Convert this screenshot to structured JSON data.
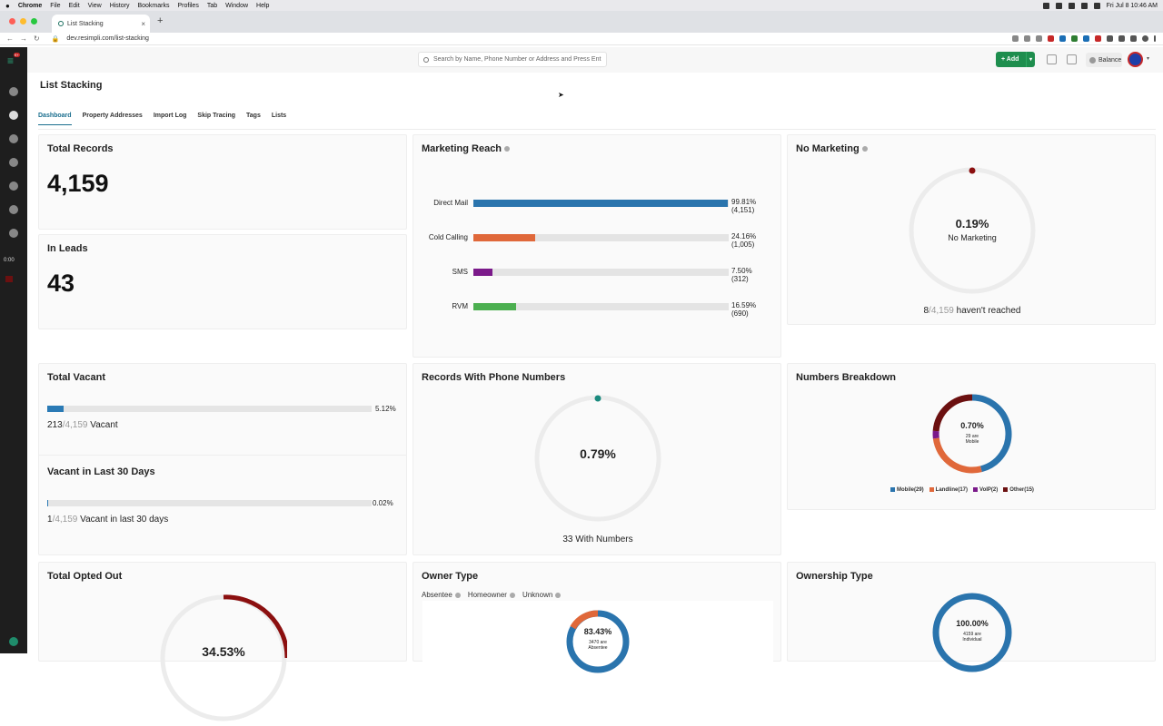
{
  "os_menu": {
    "app": "Chrome",
    "items": [
      "File",
      "Edit",
      "View",
      "History",
      "Bookmarks",
      "Profiles",
      "Tab",
      "Window",
      "Help"
    ],
    "clock": "Fri Jul 8  10:46 AM"
  },
  "browser": {
    "tab_title": "List Stacking",
    "url": "dev.resimpli.com/list-stacking"
  },
  "sidebar": {
    "badge": "9+",
    "timer": "0:00"
  },
  "topbar": {
    "search_placeholder": "Search by Name, Phone Number or Address and Press Ent",
    "add_label": "+ Add",
    "balance_label": "Balance"
  },
  "page": {
    "title": "List Stacking"
  },
  "tabs": [
    "Dashboard",
    "Property Addresses",
    "Import Log",
    "Skip Tracing",
    "Tags",
    "Lists"
  ],
  "colors": {
    "accent": "#1a6e8e",
    "green": "#1e8e4e",
    "direct_mail": "#2a74ad",
    "cold_calling": "#e0683a",
    "sms": "#7b1a8a",
    "rvm": "#4caf50",
    "mobile": "#2a74ad",
    "landline": "#e0683a",
    "voip": "#7b1a8a",
    "other": "#6b1010"
  },
  "total_records": {
    "title": "Total Records",
    "value": "4,159"
  },
  "in_leads": {
    "title": "In Leads",
    "value": "43"
  },
  "marketing_reach": {
    "title": "Marketing Reach",
    "rows": [
      {
        "label": "Direct Mail",
        "pct": "99.81%",
        "count": "(4,151)",
        "fraction": 0.9981
      },
      {
        "label": "Cold Calling",
        "pct": "24.16%",
        "count": "(1,005)",
        "fraction": 0.2416
      },
      {
        "label": "SMS",
        "pct": "7.50%",
        "count": "(312)",
        "fraction": 0.075
      },
      {
        "label": "RVM",
        "pct": "16.59%",
        "count": "(690)",
        "fraction": 0.1659
      }
    ]
  },
  "no_marketing": {
    "title": "No Marketing",
    "pct": "0.19%",
    "sub": "No Marketing",
    "count": "8",
    "total": "/4,159",
    "suffix": " haven't reached"
  },
  "total_vacant": {
    "title": "Total Vacant",
    "pct": "5.12%",
    "fraction": 0.0512,
    "count": "213",
    "total": "/4,159",
    "suffix": " Vacant"
  },
  "vacant30": {
    "title": "Vacant in Last 30 Days",
    "pct": "0.02%",
    "fraction": 0.0002,
    "count": "1",
    "total": "/4,159",
    "suffix": " Vacant in last 30 days"
  },
  "phone_numbers": {
    "title": "Records With Phone Numbers",
    "pct": "0.79%",
    "footer": "33 With Numbers"
  },
  "numbers_breakdown": {
    "title": "Numbers Breakdown",
    "center_pct": "0.70%",
    "center_sub1": "29 are",
    "center_sub2": "Mobile",
    "legend": [
      "Mobile(29)",
      "Landline(17)",
      "VoIP(2)",
      "Other(15)"
    ],
    "values": [
      29,
      17,
      2,
      15
    ]
  },
  "opted_out": {
    "title": "Total Opted Out",
    "pct": "34.53%"
  },
  "owner_type": {
    "title": "Owner Type",
    "filters": [
      "Absentee",
      "Homeowner",
      "Unknown"
    ],
    "center_pct": "83.43%",
    "sub1": "3470 are",
    "sub2": "Absentee"
  },
  "ownership_type": {
    "title": "Ownership Type",
    "center_pct": "100.00%",
    "sub1": "4159 are",
    "sub2": "Individual"
  }
}
